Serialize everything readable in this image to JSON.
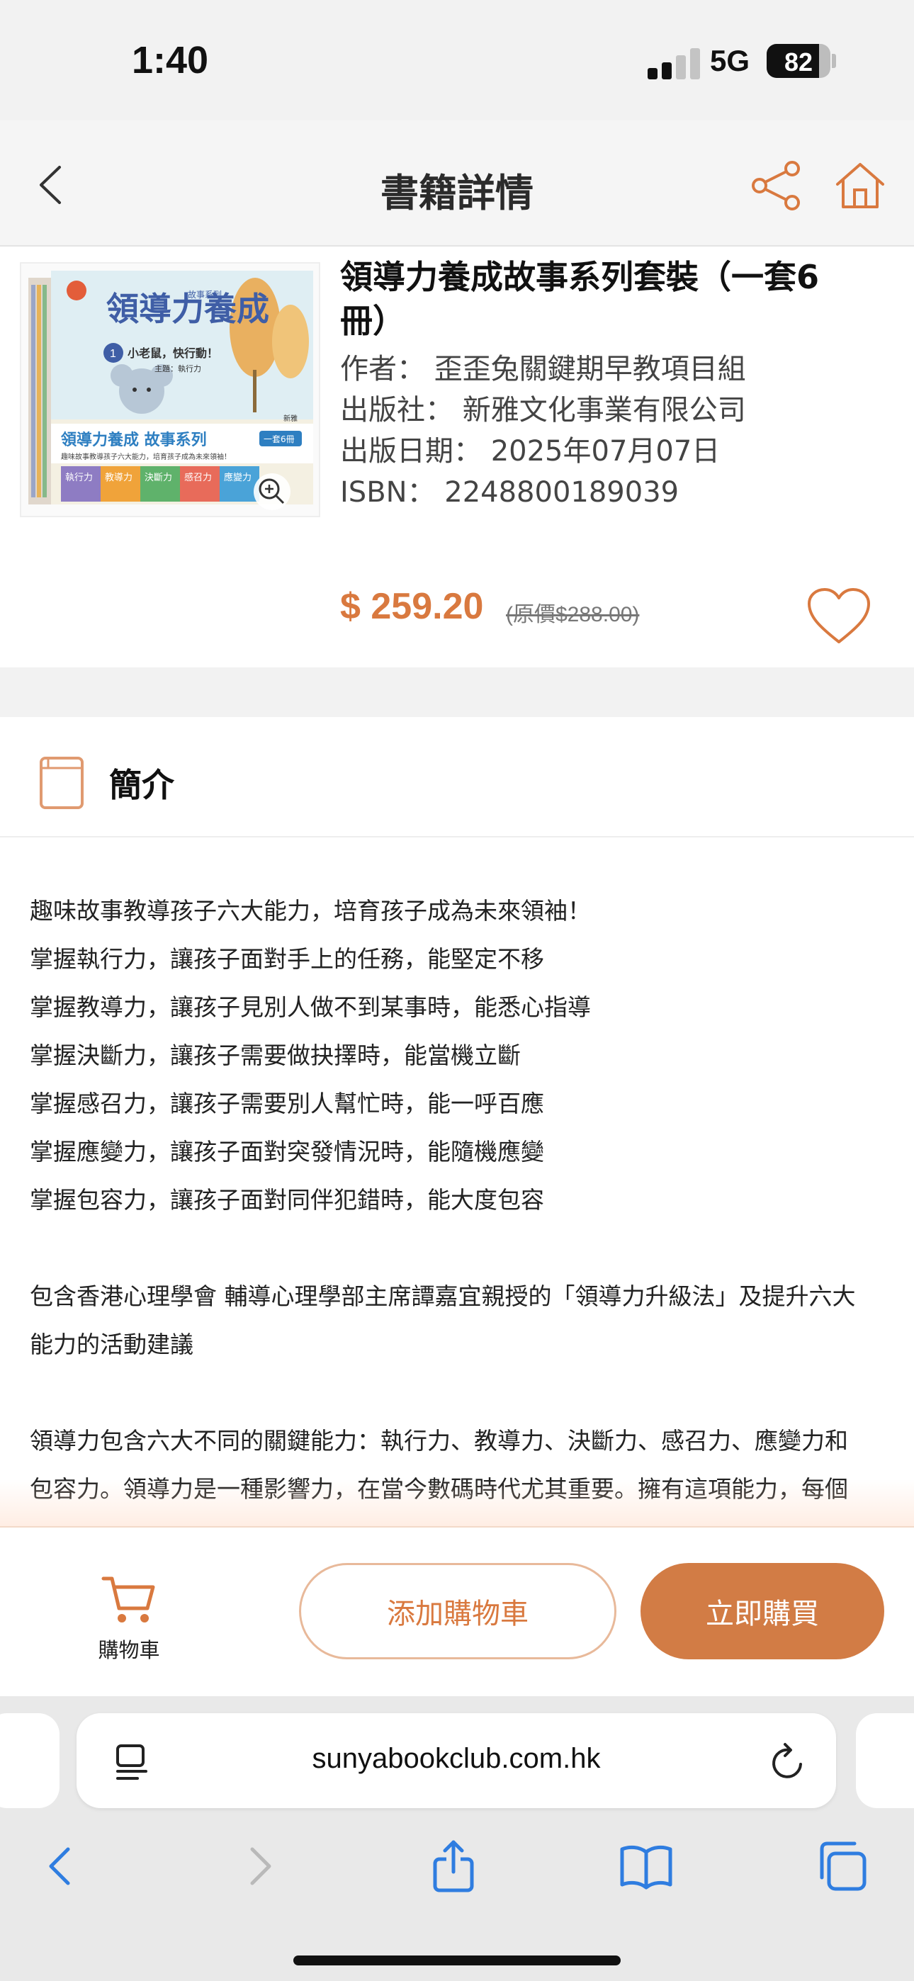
{
  "status_bar": {
    "time": "1:40",
    "network": "5G",
    "battery": "82",
    "battery_level": 0.82
  },
  "header": {
    "title": "書籍詳情",
    "back_icon": "chevron-left-icon",
    "share_icon": "share-icon",
    "home_icon": "home-icon"
  },
  "product": {
    "title": "領導力養成故事系列套裝（一套6冊）",
    "author": "作者： 歪歪兔關鍵期早教項目組",
    "publisher": "出版社： 新雅文化事業有限公司",
    "publish_date": "出版日期： 2025年07月07日",
    "isbn": "ISBN： 2248800189039",
    "price": "$ 259.20",
    "original_price": "(原價$288.00)",
    "cover": {
      "title": "領導力養成",
      "series_tag": "故事系列",
      "volume_title": "小老鼠，快行動！",
      "theme": "主題：執行力",
      "box_title": "領導力養成 故事系列",
      "box_set": "一套6冊",
      "box_tagline": "趣味故事教導孩子六大能力，培育孩子成為未來領袖！",
      "spines": [
        "執行力",
        "教導力",
        "決斷力",
        "感召力",
        "應變力"
      ],
      "publisher_mark": "新雅"
    },
    "accent_color": "#d9793f"
  },
  "intro": {
    "title": "簡介",
    "lines": [
      "趣味故事教導孩子六大能力，培育孩子成為未來領袖！",
      "掌握執行力，讓孩子面對手上的任務，能堅定不移",
      "掌握教導力，讓孩子見別人做不到某事時，能悉心指導",
      "掌握決斷力，讓孩子需要做抉擇時，能當機立斷",
      "掌握感召力，讓孩子需要別人幫忙時，能一呼百應",
      "掌握應變力，讓孩子面對突發情況時，能隨機應變",
      "掌握包容力，讓孩子面對同伴犯錯時，能大度包容"
    ],
    "paragraph2_line1": "包含香港心理學會 輔導心理學部主席譚嘉宜親授的「領導力升級法」及提升六大",
    "paragraph2_line2": "能力的活動建議",
    "paragraph3_line1": "領導力包含六大不同的關鍵能力：執行力、教導力、決斷力、感召力、應變力和",
    "paragraph3_line2": "包容力。領導力是一種影響力，在當今數碼時代尤其重要。擁有這項能力，每個"
  },
  "actions": {
    "cart_label": "購物車",
    "add_to_cart": "添加購物車",
    "buy_now": "立即購買",
    "buy_color": "#d27c45"
  },
  "browser": {
    "url": "sunyabookclub.com.hk"
  }
}
